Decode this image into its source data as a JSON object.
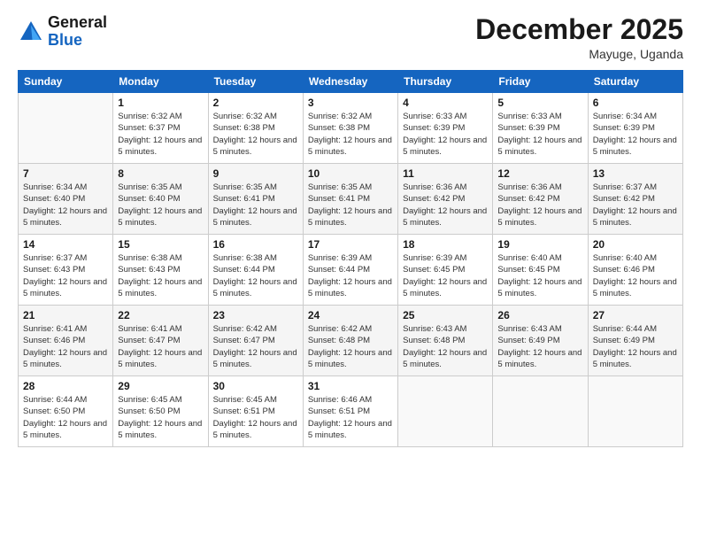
{
  "header": {
    "logo_line1": "General",
    "logo_line2": "Blue",
    "main_title": "December 2025",
    "subtitle": "Mayuge, Uganda"
  },
  "columns": [
    "Sunday",
    "Monday",
    "Tuesday",
    "Wednesday",
    "Thursday",
    "Friday",
    "Saturday"
  ],
  "weeks": [
    [
      {
        "day": "",
        "sunrise": "",
        "sunset": "",
        "daylight": ""
      },
      {
        "day": "1",
        "sunrise": "Sunrise: 6:32 AM",
        "sunset": "Sunset: 6:37 PM",
        "daylight": "Daylight: 12 hours and 5 minutes."
      },
      {
        "day": "2",
        "sunrise": "Sunrise: 6:32 AM",
        "sunset": "Sunset: 6:38 PM",
        "daylight": "Daylight: 12 hours and 5 minutes."
      },
      {
        "day": "3",
        "sunrise": "Sunrise: 6:32 AM",
        "sunset": "Sunset: 6:38 PM",
        "daylight": "Daylight: 12 hours and 5 minutes."
      },
      {
        "day": "4",
        "sunrise": "Sunrise: 6:33 AM",
        "sunset": "Sunset: 6:39 PM",
        "daylight": "Daylight: 12 hours and 5 minutes."
      },
      {
        "day": "5",
        "sunrise": "Sunrise: 6:33 AM",
        "sunset": "Sunset: 6:39 PM",
        "daylight": "Daylight: 12 hours and 5 minutes."
      },
      {
        "day": "6",
        "sunrise": "Sunrise: 6:34 AM",
        "sunset": "Sunset: 6:39 PM",
        "daylight": "Daylight: 12 hours and 5 minutes."
      }
    ],
    [
      {
        "day": "7",
        "sunrise": "Sunrise: 6:34 AM",
        "sunset": "Sunset: 6:40 PM",
        "daylight": "Daylight: 12 hours and 5 minutes."
      },
      {
        "day": "8",
        "sunrise": "Sunrise: 6:35 AM",
        "sunset": "Sunset: 6:40 PM",
        "daylight": "Daylight: 12 hours and 5 minutes."
      },
      {
        "day": "9",
        "sunrise": "Sunrise: 6:35 AM",
        "sunset": "Sunset: 6:41 PM",
        "daylight": "Daylight: 12 hours and 5 minutes."
      },
      {
        "day": "10",
        "sunrise": "Sunrise: 6:35 AM",
        "sunset": "Sunset: 6:41 PM",
        "daylight": "Daylight: 12 hours and 5 minutes."
      },
      {
        "day": "11",
        "sunrise": "Sunrise: 6:36 AM",
        "sunset": "Sunset: 6:42 PM",
        "daylight": "Daylight: 12 hours and 5 minutes."
      },
      {
        "day": "12",
        "sunrise": "Sunrise: 6:36 AM",
        "sunset": "Sunset: 6:42 PM",
        "daylight": "Daylight: 12 hours and 5 minutes."
      },
      {
        "day": "13",
        "sunrise": "Sunrise: 6:37 AM",
        "sunset": "Sunset: 6:42 PM",
        "daylight": "Daylight: 12 hours and 5 minutes."
      }
    ],
    [
      {
        "day": "14",
        "sunrise": "Sunrise: 6:37 AM",
        "sunset": "Sunset: 6:43 PM",
        "daylight": "Daylight: 12 hours and 5 minutes."
      },
      {
        "day": "15",
        "sunrise": "Sunrise: 6:38 AM",
        "sunset": "Sunset: 6:43 PM",
        "daylight": "Daylight: 12 hours and 5 minutes."
      },
      {
        "day": "16",
        "sunrise": "Sunrise: 6:38 AM",
        "sunset": "Sunset: 6:44 PM",
        "daylight": "Daylight: 12 hours and 5 minutes."
      },
      {
        "day": "17",
        "sunrise": "Sunrise: 6:39 AM",
        "sunset": "Sunset: 6:44 PM",
        "daylight": "Daylight: 12 hours and 5 minutes."
      },
      {
        "day": "18",
        "sunrise": "Sunrise: 6:39 AM",
        "sunset": "Sunset: 6:45 PM",
        "daylight": "Daylight: 12 hours and 5 minutes."
      },
      {
        "day": "19",
        "sunrise": "Sunrise: 6:40 AM",
        "sunset": "Sunset: 6:45 PM",
        "daylight": "Daylight: 12 hours and 5 minutes."
      },
      {
        "day": "20",
        "sunrise": "Sunrise: 6:40 AM",
        "sunset": "Sunset: 6:46 PM",
        "daylight": "Daylight: 12 hours and 5 minutes."
      }
    ],
    [
      {
        "day": "21",
        "sunrise": "Sunrise: 6:41 AM",
        "sunset": "Sunset: 6:46 PM",
        "daylight": "Daylight: 12 hours and 5 minutes."
      },
      {
        "day": "22",
        "sunrise": "Sunrise: 6:41 AM",
        "sunset": "Sunset: 6:47 PM",
        "daylight": "Daylight: 12 hours and 5 minutes."
      },
      {
        "day": "23",
        "sunrise": "Sunrise: 6:42 AM",
        "sunset": "Sunset: 6:47 PM",
        "daylight": "Daylight: 12 hours and 5 minutes."
      },
      {
        "day": "24",
        "sunrise": "Sunrise: 6:42 AM",
        "sunset": "Sunset: 6:48 PM",
        "daylight": "Daylight: 12 hours and 5 minutes."
      },
      {
        "day": "25",
        "sunrise": "Sunrise: 6:43 AM",
        "sunset": "Sunset: 6:48 PM",
        "daylight": "Daylight: 12 hours and 5 minutes."
      },
      {
        "day": "26",
        "sunrise": "Sunrise: 6:43 AM",
        "sunset": "Sunset: 6:49 PM",
        "daylight": "Daylight: 12 hours and 5 minutes."
      },
      {
        "day": "27",
        "sunrise": "Sunrise: 6:44 AM",
        "sunset": "Sunset: 6:49 PM",
        "daylight": "Daylight: 12 hours and 5 minutes."
      }
    ],
    [
      {
        "day": "28",
        "sunrise": "Sunrise: 6:44 AM",
        "sunset": "Sunset: 6:50 PM",
        "daylight": "Daylight: 12 hours and 5 minutes."
      },
      {
        "day": "29",
        "sunrise": "Sunrise: 6:45 AM",
        "sunset": "Sunset: 6:50 PM",
        "daylight": "Daylight: 12 hours and 5 minutes."
      },
      {
        "day": "30",
        "sunrise": "Sunrise: 6:45 AM",
        "sunset": "Sunset: 6:51 PM",
        "daylight": "Daylight: 12 hours and 5 minutes."
      },
      {
        "day": "31",
        "sunrise": "Sunrise: 6:46 AM",
        "sunset": "Sunset: 6:51 PM",
        "daylight": "Daylight: 12 hours and 5 minutes."
      },
      {
        "day": "",
        "sunrise": "",
        "sunset": "",
        "daylight": ""
      },
      {
        "day": "",
        "sunrise": "",
        "sunset": "",
        "daylight": ""
      },
      {
        "day": "",
        "sunrise": "",
        "sunset": "",
        "daylight": ""
      }
    ]
  ]
}
